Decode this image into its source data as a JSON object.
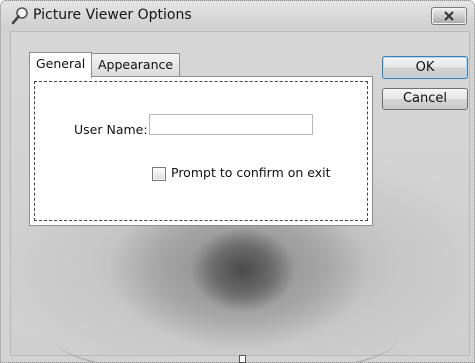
{
  "window": {
    "title": "Picture Viewer Options",
    "title_icon": "magnifier-icon"
  },
  "tabs": [
    {
      "label": "General",
      "selected": true
    },
    {
      "label": "Appearance",
      "selected": false
    }
  ],
  "general": {
    "user_name_label": "User Name:",
    "user_name_value": "",
    "prompt_checkbox_label": "Prompt to confirm on exit",
    "prompt_checked": false
  },
  "buttons": {
    "ok_label": "OK",
    "cancel_label": "Cancel"
  },
  "colors": {
    "default_button_border": "#3c7fb1"
  }
}
